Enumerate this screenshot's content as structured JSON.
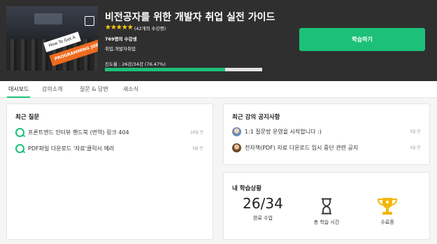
{
  "course": {
    "title": "비전공자를 위한 개발자 취업 실전 가이드",
    "rating_stars": "★★★★★",
    "rating_text": "(42개의 수강평)",
    "students": "769명의 수강생",
    "category": "취업,개발자취업",
    "progress_text": "진도율 : 26강/34강 (76.47%)",
    "progress_percent": 76.47,
    "thumbnail_sign_top": "How To Get A",
    "thumbnail_sign_bottom": "PROGRAMMING JOB",
    "learn_button": "학습하기"
  },
  "tabs": [
    {
      "label": "대시보드",
      "active": true
    },
    {
      "label": "강의소개",
      "active": false
    },
    {
      "label": "질문 & 답변",
      "active": false
    },
    {
      "label": "새소식",
      "active": false
    }
  ],
  "recent_questions": {
    "title": "최근 질문",
    "items": [
      {
        "text": "프론트엔드 인터뷰 핸드북 (번역) 링크 404",
        "date": "28일 전"
      },
      {
        "text": "PDF파일 다운로드 '자료'클릭시 에러",
        "date": "3달 전"
      }
    ]
  },
  "notices": {
    "title": "최근 강의 공지사항",
    "items": [
      {
        "text": "1:1 질문방 운영을 시작합니다 :)",
        "date": "3달 전"
      },
      {
        "text": "전자책(PDF) 자료 다운로드 임시 중단 관련 공지",
        "date": "3달 전"
      }
    ]
  },
  "learning_status": {
    "title": "내 학습상황",
    "completed_value": "26/34",
    "completed_label": "완료 수업",
    "time_label": "총 학습 시간",
    "certificate_label": "수료증"
  },
  "colors": {
    "accent": "#1dc078",
    "header_bg": "#2f2f2f",
    "star": "#fdcc11",
    "trophy": "#f2b705"
  }
}
